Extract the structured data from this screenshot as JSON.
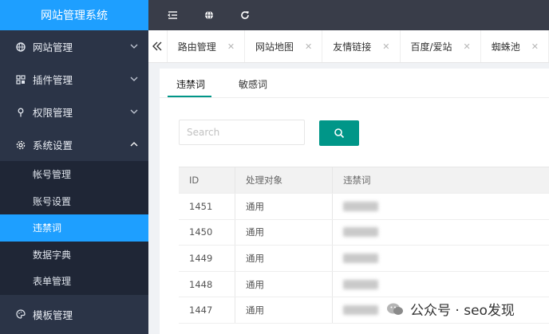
{
  "brand": {
    "title": "网站管理系统",
    "color": "#1e9fff"
  },
  "sidebar": {
    "menus": [
      {
        "label": "网站管理",
        "icon": "globe-icon",
        "expanded": false
      },
      {
        "label": "插件管理",
        "icon": "grid-icon",
        "expanded": false
      },
      {
        "label": "权限管理",
        "icon": "key-icon",
        "expanded": false
      },
      {
        "label": "系统设置",
        "icon": "gear-icon",
        "expanded": true
      }
    ],
    "submenu": [
      {
        "label": "帐号管理",
        "active": false
      },
      {
        "label": "账号设置",
        "active": false
      },
      {
        "label": "违禁词",
        "active": true
      },
      {
        "label": "数据字典",
        "active": false
      },
      {
        "label": "表单管理",
        "active": false
      }
    ],
    "bottom_menu": {
      "label": "模板管理",
      "icon": "palette-icon"
    }
  },
  "topbar": {
    "icons": [
      "collapse-menu-icon",
      "globe-icon",
      "refresh-icon"
    ]
  },
  "tabs": [
    "路由管理",
    "网站地图",
    "友情链接",
    "百度/爱站",
    "蜘蛛池"
  ],
  "subtabs": [
    "违禁词",
    "敏感词"
  ],
  "search": {
    "placeholder": "Search"
  },
  "table": {
    "headers": [
      "ID",
      "处理对象",
      "违禁词"
    ],
    "rows": [
      {
        "id": "1451",
        "target": "通用"
      },
      {
        "id": "1450",
        "target": "通用"
      },
      {
        "id": "1449",
        "target": "通用"
      },
      {
        "id": "1448",
        "target": "通用"
      },
      {
        "id": "1447",
        "target": "通用"
      }
    ]
  },
  "watermark": {
    "text": "公众号 · seo发现"
  }
}
